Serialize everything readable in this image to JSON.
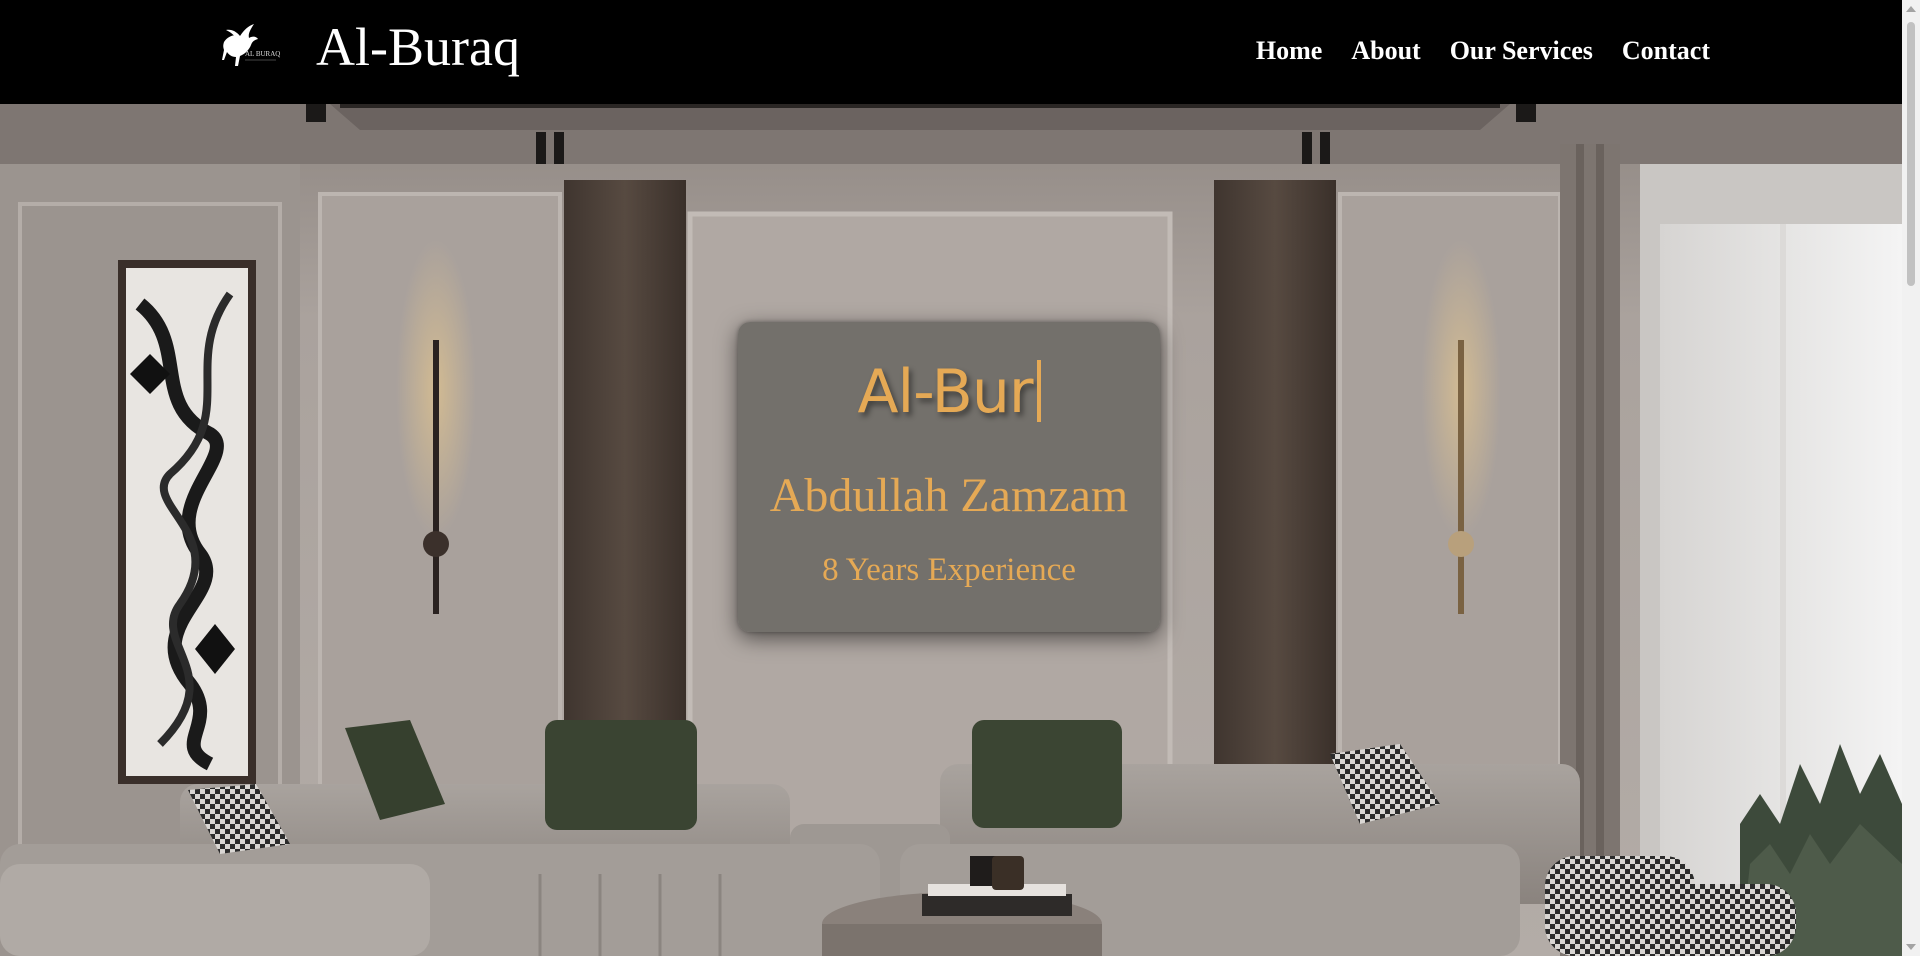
{
  "header": {
    "logo_icon": "pegasus-logo-icon",
    "logo_caption": "AL BURAQ",
    "title": "Al-Buraq",
    "nav": [
      {
        "label": "Home"
      },
      {
        "label": "About"
      },
      {
        "label": "Our Services"
      },
      {
        "label": "Contact"
      }
    ]
  },
  "hero": {
    "image": "luxury-living-room-interior",
    "card": {
      "typing_text": "Al-Bur",
      "name": "Abdullah Zamzam",
      "experience": "8 Years Experience"
    }
  },
  "colors": {
    "header_bg": "#000000",
    "accent_gold": "#e5a955",
    "card_bg": "#69665f"
  }
}
